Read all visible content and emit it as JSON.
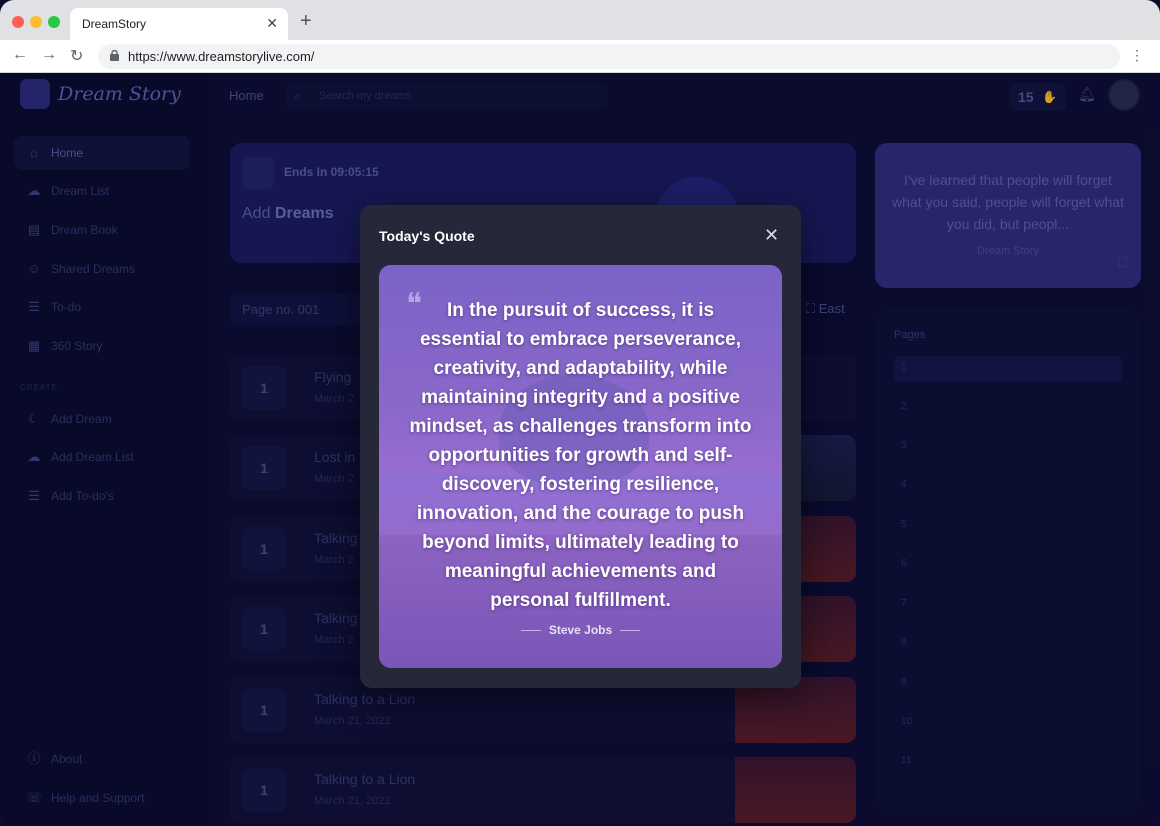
{
  "browser": {
    "tab_title": "DreamStory",
    "url": "https://www.dreamstorylive.com/"
  },
  "app": {
    "logo_text": "Dream Story",
    "topbar": {
      "home": "Home",
      "search_placeholder": "Search my dreams",
      "streak": "15"
    },
    "sidebar": {
      "items": [
        {
          "label": "Home",
          "icon": "home-icon"
        },
        {
          "label": "Dream List",
          "icon": "cloud-icon"
        },
        {
          "label": "Dream Book",
          "icon": "book-icon"
        },
        {
          "label": "Shared Dreams",
          "icon": "shared-icon"
        },
        {
          "label": "To-do",
          "icon": "list-icon"
        },
        {
          "label": "360 Story",
          "icon": "story-icon"
        }
      ],
      "create_label": "CREATE",
      "create_items": [
        {
          "label": "Add Dream",
          "icon": "moon-icon"
        },
        {
          "label": "Add Dream List",
          "icon": "cloud-icon"
        },
        {
          "label": "Add To-do's",
          "icon": "list-icon"
        }
      ],
      "footer_items": [
        {
          "label": "About",
          "icon": "info-icon"
        },
        {
          "label": "Help and Support",
          "icon": "support-icon"
        }
      ]
    },
    "banner": {
      "timer": "Ends In 09:05:15",
      "add": "Add",
      "add_bold": "Dreams"
    },
    "quote_card": {
      "text": "I've learned that people will forget what you said, people will forget what you did, but peopl...",
      "author": "Dream Story"
    },
    "page_selector": "Page no. 001",
    "direction": "East",
    "dreams": [
      {
        "num": "1",
        "title": "Flying",
        "date": "March 2"
      },
      {
        "num": "1",
        "title": "Lost in",
        "date": "March 2"
      },
      {
        "num": "1",
        "title": "Talking",
        "date": "March 2"
      },
      {
        "num": "1",
        "title": "Talking",
        "date": "March 2"
      },
      {
        "num": "1",
        "title": "Talking to a Lion",
        "date": "March 21, 2022"
      },
      {
        "num": "1",
        "title": "Talking to a Lion",
        "date": "March 21, 2022"
      }
    ],
    "pages_title": "Pages",
    "pages": [
      "1",
      "2",
      "3",
      "4",
      "5",
      "6",
      "7",
      "8",
      "9",
      "10",
      "11"
    ]
  },
  "modal": {
    "title": "Today's Quote",
    "quote": "In the pursuit of success, it is essential to embrace perseverance, creativity, and adaptability, while maintaining integrity and a positive mindset, as challenges transform into opportunities for growth and self-discovery, fostering resilience, innovation, and the courage to push beyond limits, ultimately leading to meaningful achievements and personal fulfillment.",
    "author": "Steve Jobs"
  }
}
